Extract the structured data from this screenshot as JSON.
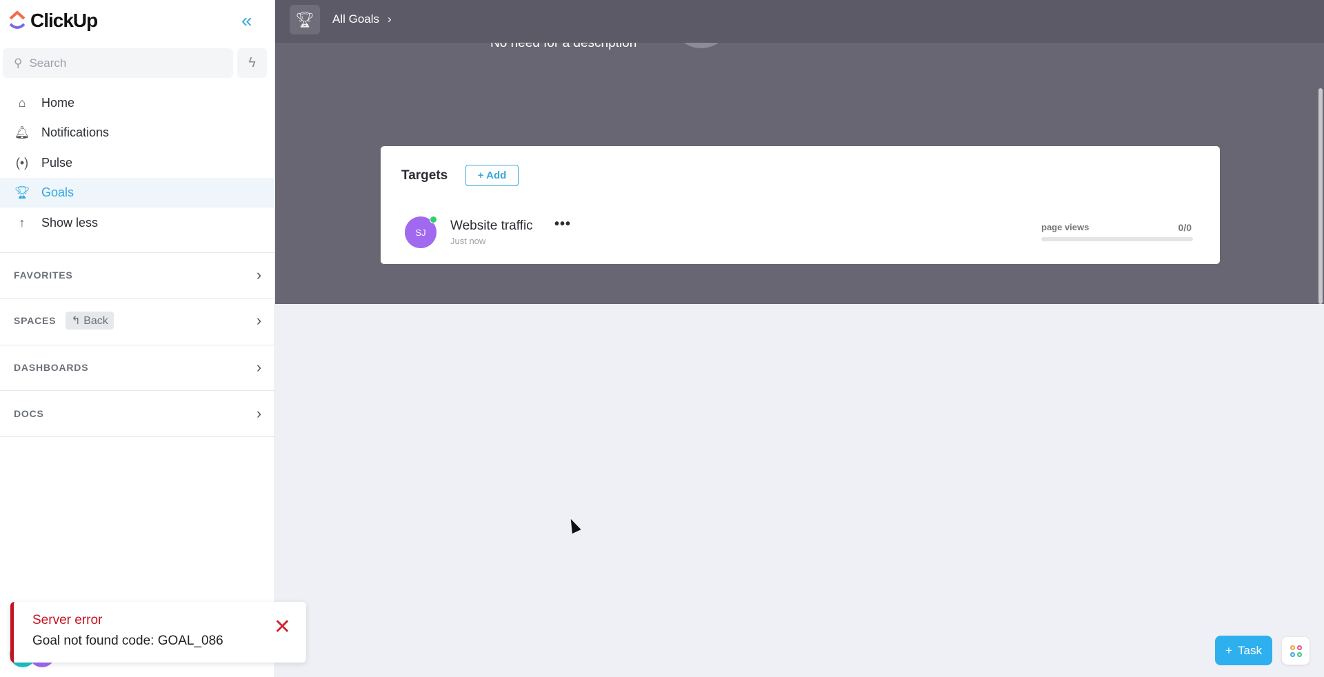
{
  "sidebar": {
    "brand": "ClickUp",
    "search_placeholder": "Search",
    "nav": [
      {
        "label": "Home",
        "icon": "home-icon"
      },
      {
        "label": "Notifications",
        "icon": "bell-icon"
      },
      {
        "label": "Pulse",
        "icon": "pulse-icon"
      },
      {
        "label": "Goals",
        "icon": "trophy-icon",
        "active": true
      },
      {
        "label": "Show less",
        "icon": "arrow-up-icon"
      }
    ],
    "sections": {
      "favorites": "FAVORITES",
      "spaces": "SPACES",
      "back": "Back",
      "dashboards": "DASHBOARDS",
      "docs": "DOCS"
    }
  },
  "header": {
    "breadcrumb": "All Goals"
  },
  "goal": {
    "description": "No need for a description"
  },
  "targets": {
    "title": "Targets",
    "add_label": "+ Add",
    "items": [
      {
        "avatar": "SJ",
        "name": "Website traffic",
        "time": "Just now",
        "unit": "page views",
        "value": "0/0",
        "progress": 0
      }
    ]
  },
  "toast": {
    "title": "Server error",
    "message": "Goal not found code: GOAL_086"
  },
  "fab": {
    "task_label": "Task"
  },
  "colors": {
    "accent": "#2ea8dd",
    "error": "#c4121f",
    "avatar": "#a069f0"
  }
}
